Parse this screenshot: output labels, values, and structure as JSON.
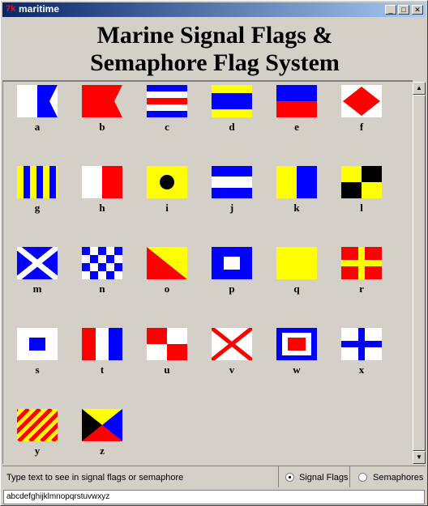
{
  "window": {
    "title": "maritime",
    "app_icon": "tk-icon"
  },
  "heading": {
    "line1": "Marine Signal Flags &",
    "line2": "Semaphore Flag System"
  },
  "flags": [
    {
      "letter": "a",
      "design": "a"
    },
    {
      "letter": "b",
      "design": "b"
    },
    {
      "letter": "c",
      "design": "c"
    },
    {
      "letter": "d",
      "design": "d"
    },
    {
      "letter": "e",
      "design": "e"
    },
    {
      "letter": "f",
      "design": "f"
    },
    {
      "letter": "g",
      "design": "g"
    },
    {
      "letter": "h",
      "design": "h"
    },
    {
      "letter": "i",
      "design": "i"
    },
    {
      "letter": "j",
      "design": "j"
    },
    {
      "letter": "k",
      "design": "k"
    },
    {
      "letter": "l",
      "design": "l"
    },
    {
      "letter": "m",
      "design": "m"
    },
    {
      "letter": "n",
      "design": "n"
    },
    {
      "letter": "o",
      "design": "o"
    },
    {
      "letter": "p",
      "design": "p"
    },
    {
      "letter": "q",
      "design": "q"
    },
    {
      "letter": "r",
      "design": "r"
    },
    {
      "letter": "s",
      "design": "s"
    },
    {
      "letter": "t",
      "design": "t"
    },
    {
      "letter": "u",
      "design": "u"
    },
    {
      "letter": "v",
      "design": "v"
    },
    {
      "letter": "w",
      "design": "w"
    },
    {
      "letter": "x",
      "design": "x"
    },
    {
      "letter": "y",
      "design": "y"
    },
    {
      "letter": "z",
      "design": "z"
    }
  ],
  "colors": {
    "blue": "#0000ff",
    "red": "#ff0000",
    "yellow": "#ffff00",
    "white": "#ffffff",
    "black": "#000000"
  },
  "bottom": {
    "hint": "Type text to see in signal flags or semaphore",
    "options": [
      {
        "label": "Signal Flags",
        "selected": true
      },
      {
        "label": "Semaphores",
        "selected": false
      }
    ]
  },
  "input": {
    "value": "abcdefghijklmnopqrstuvwxyz"
  }
}
